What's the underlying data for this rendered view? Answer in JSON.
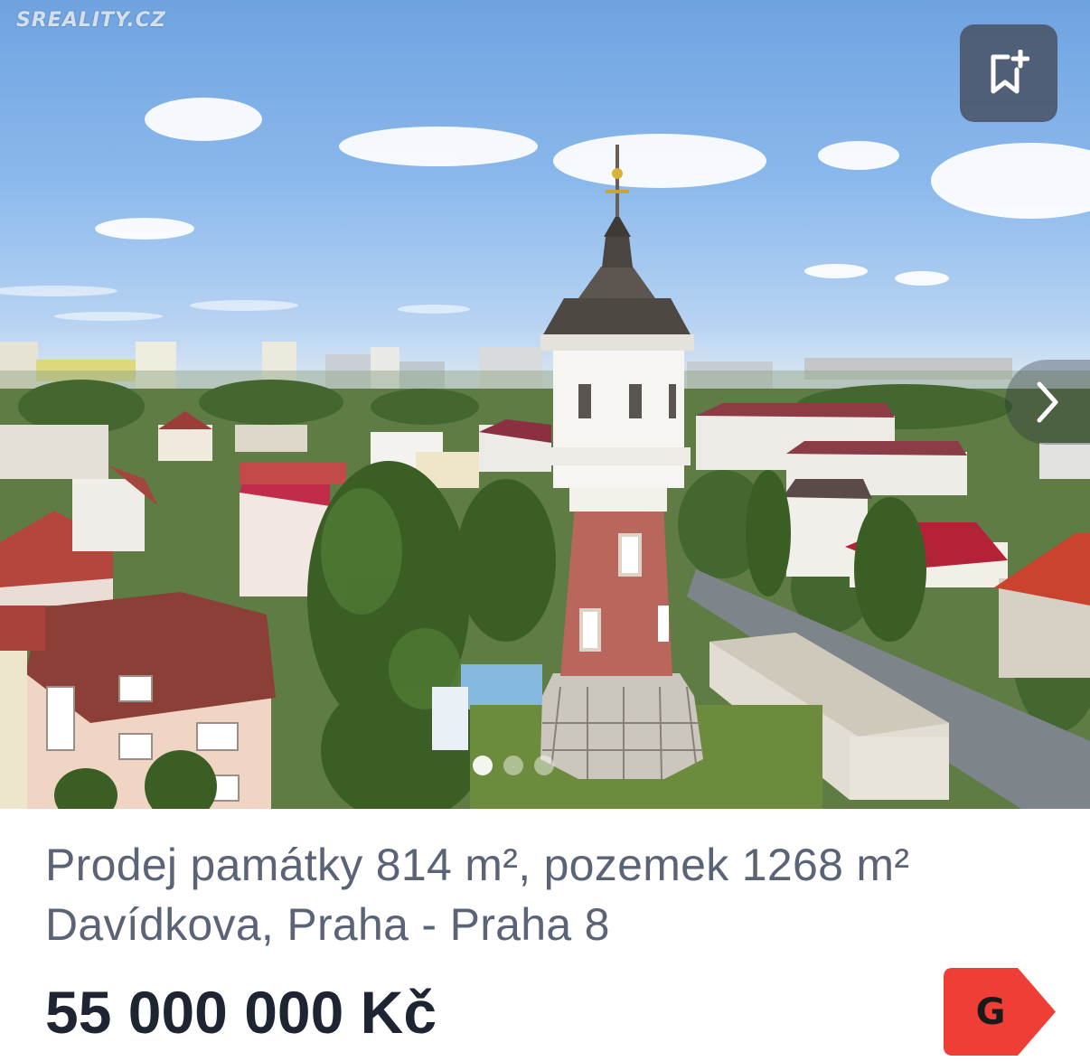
{
  "photo": {
    "watermark": "SREALITY.CZ",
    "save_icon": "bookmark-plus-icon",
    "next_icon": "chevron-right-icon",
    "dot_count": 3,
    "active_dot": 0
  },
  "listing": {
    "title": "Prodej památky 814 m², pozemek 1268 m²",
    "location": "Davídkova, Praha - Praha 8",
    "price": "55 000 000 Kč",
    "energy_class": "G"
  },
  "colors": {
    "energy_badge": "#ef3e36",
    "title_text": "#5b6377",
    "price_text": "#1f2433"
  }
}
